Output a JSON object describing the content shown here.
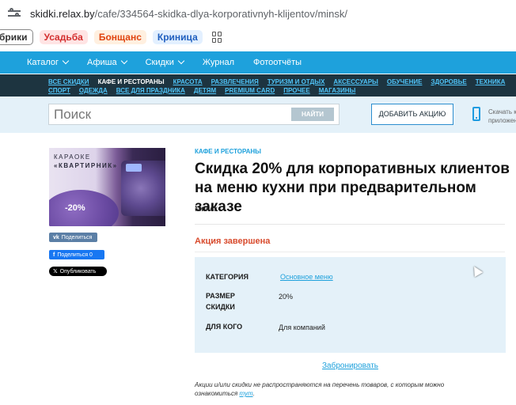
{
  "browser": {
    "url_domain": "skidki.relax.by",
    "url_path": "/cafe/334564-skidka-dlya-korporativnyh-klijentov/minsk/",
    "bookmarks": [
      "брики",
      "Усадьба",
      "Бонщанс",
      "Криница"
    ]
  },
  "nav": {
    "items": [
      "Каталог",
      "Афиша",
      "Скидки",
      "Журнал",
      "Фотоотчёты"
    ]
  },
  "categories": {
    "row1": [
      "ВСЕ СКИДКИ",
      "КАФЕ И РЕСТОРАНЫ",
      "КРАСОТА",
      "РАЗВЛЕЧЕНИЯ",
      "ТУРИЗМ И ОТДЫХ",
      "АКСЕССУАРЫ",
      "ОБУЧЕНИЕ",
      "ЗДОРОВЬЕ",
      "ТЕХНИКА"
    ],
    "row2": [
      "СПОРТ",
      "ОДЕЖДА",
      "ВСЕ ДЛЯ ПРАЗДНИКА",
      "ДЕТЯМ",
      "PREMIUM CARD",
      "ПРОЧЕЕ",
      "МАГАЗИНЫ"
    ],
    "active": "КАФЕ И РЕСТОРАНЫ"
  },
  "search": {
    "placeholder": "Поиск",
    "button": "НАЙТИ",
    "add_button": "ДОБАВИТЬ АКЦИЮ",
    "app_note_line1": "Скачать к",
    "app_note_line2": "приложен"
  },
  "promo": {
    "line1": "КАРАОКЕ",
    "line2": "«КВАРТИРНИК»",
    "discount": "-20%"
  },
  "share": {
    "vk": "Поделиться",
    "fb": "Поделиться 0",
    "tw": "Опубликовать"
  },
  "deal": {
    "breadcrumb": "КАФЕ И РЕСТОРАНЫ",
    "title": "Скидка 20% для корпоративных клиентов на меню кухни при предварительном заказе",
    "city": "Минск",
    "status": "Акция завершена",
    "category_label": "КАТЕГОРИЯ",
    "category_value": "Основное меню",
    "size_label_1": "РАЗМЕР",
    "size_label_2": "СКИДКИ",
    "size_value": "20%",
    "for_label": "ДЛЯ КОГО",
    "for_value": "Для компаний",
    "book_link": "Забронировать",
    "note_text": "Акции и/или скидки не распространяются на перечень товаров, с которым можно ознакомиться",
    "note_link": "тут"
  }
}
